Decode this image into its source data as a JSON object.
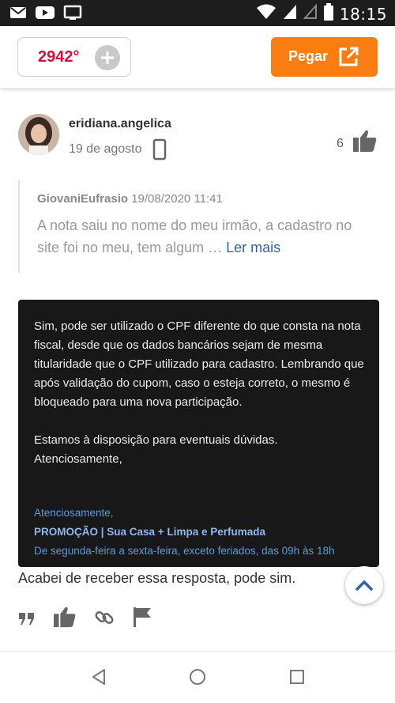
{
  "status_bar": {
    "time": "18:15",
    "icons": [
      "mail-icon",
      "youtube-icon",
      "cast-icon",
      "wifi-icon",
      "signal-icon",
      "signal-empty-icon",
      "battery-icon"
    ]
  },
  "header": {
    "temperature": "2942°",
    "plus_icon": "plus-icon",
    "get_button_label": "Pegar",
    "get_button_icon": "external-link-icon",
    "accent_color": "#f97d10",
    "temp_color": "#d0113b"
  },
  "comment": {
    "username": "eridiana.angelica",
    "date": "19 de agosto",
    "device_icon": "mobile-phone-icon",
    "likes": "6",
    "quote": {
      "user": "GiovaniEufrasio",
      "timestamp": "19/08/2020 11:41",
      "text": "A nota saiu no nome do meu irmão, a cadastro no site foi no meu, tem algum …",
      "read_more": "Ler mais"
    },
    "image_card": {
      "paragraph1": "Sim, pode ser utilizado o CPF diferente do que consta na nota fiscal, desde que os dados bancários sejam de mesma titularidade que o CPF utilizado para cadastro. Lembrando que após validação do cupom, caso o esteja correto, o mesmo é bloqueado para uma nova participação.",
      "paragraph2": "Estamos à disposição para eventuais dúvidas.",
      "paragraph3": "Atenciosamente,",
      "sig_line1": "Atenciosamente,",
      "sig_line2": "PROMOÇÃO | Sua Casa + Limpa e Perfumada",
      "sig_line3": "De segunda-feira a sexta-feira, exceto feriados, das 09h às 18h"
    },
    "body": "Acabei de receber essa resposta, pode sim.",
    "actions": [
      "quote-icon",
      "like-icon",
      "link-icon",
      "flag-icon"
    ]
  },
  "nav": {
    "buttons": [
      "back-icon",
      "home-icon",
      "recents-icon"
    ]
  }
}
